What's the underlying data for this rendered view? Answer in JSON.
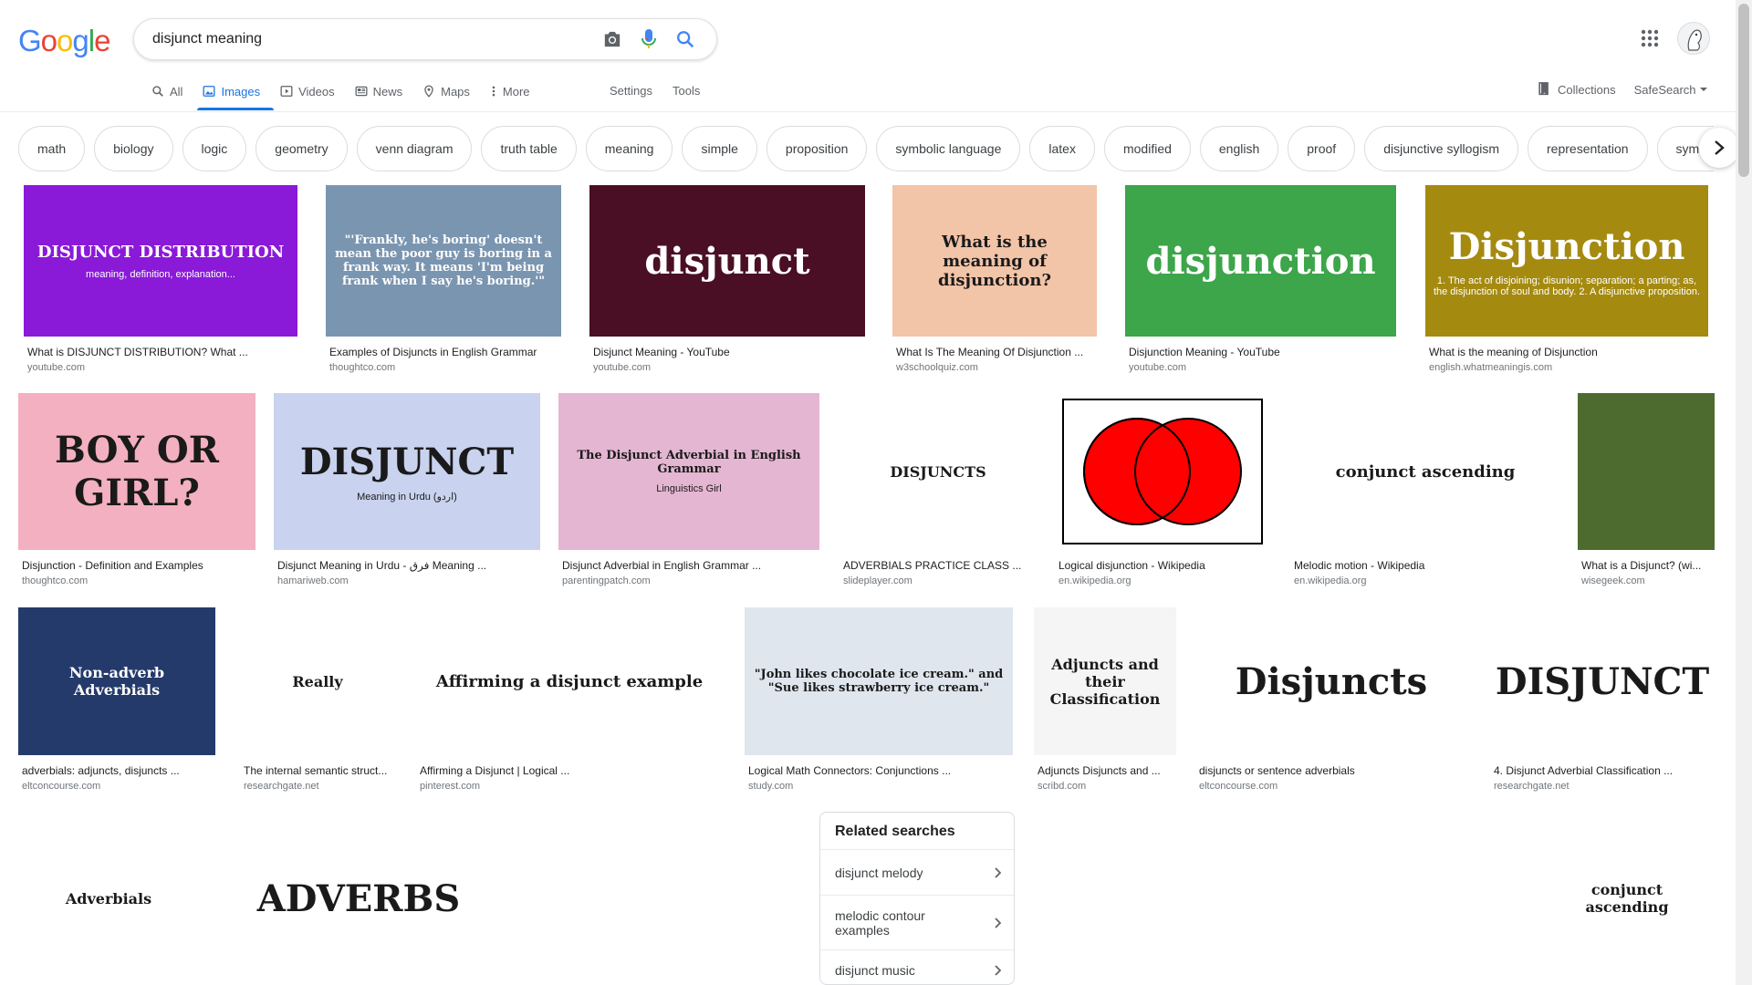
{
  "logo": {
    "letters": [
      "G",
      "o",
      "o",
      "g",
      "l",
      "e"
    ],
    "colors": [
      "#4285f4",
      "#ea4335",
      "#fbbc05",
      "#4285f4",
      "#34a853",
      "#ea4335"
    ]
  },
  "search": {
    "value": "disjunct meaning"
  },
  "tabs": [
    {
      "label": "All",
      "icon": "search-icon"
    },
    {
      "label": "Images",
      "icon": "image-icon",
      "active": true
    },
    {
      "label": "Videos",
      "icon": "play-icon"
    },
    {
      "label": "News",
      "icon": "news-icon"
    },
    {
      "label": "Maps",
      "icon": "map-pin-icon"
    },
    {
      "label": "More",
      "icon": "more-vert-icon"
    }
  ],
  "tools": {
    "settings": "Settings",
    "tools": "Tools"
  },
  "right_tools": {
    "collections": "Collections",
    "safesearch": "SafeSearch"
  },
  "chips": [
    "math",
    "biology",
    "logic",
    "geometry",
    "venn diagram",
    "truth table",
    "meaning",
    "simple",
    "proposition",
    "symbolic language",
    "latex",
    "modified",
    "english",
    "proof",
    "disjunctive syllogism",
    "representation",
    "symmetric"
  ],
  "results": [
    {
      "caption": "What is DISJUNCT DISTRIBUTION? What ...",
      "source": "youtube.com",
      "thumb_text": "DISJUNCT DISTRIBUTION",
      "thumb_sub": "meaning, definition, explanation...",
      "bg": "#8a19d8"
    },
    {
      "caption": "Examples of Disjuncts in English Grammar",
      "source": "thoughtco.com",
      "thumb_text": "\"'Frankly, he's boring' doesn't mean the poor guy is boring in a frank way. It means 'I'm being frank when I say he's boring.'\"",
      "bg": "#7a95b0"
    },
    {
      "caption": "Disjunct Meaning - YouTube",
      "source": "youtube.com",
      "thumb_text": "disjunct",
      "bg": "#4a0f24"
    },
    {
      "caption": "What Is The Meaning Of Disjunction ...",
      "source": "w3schoolquiz.com",
      "thumb_text": "What is the meaning of disjunction?",
      "bg": "#f2c4a8"
    },
    {
      "caption": "Disjunction Meaning - YouTube",
      "source": "youtube.com",
      "thumb_text": "disjunction",
      "bg": "#3da54a"
    },
    {
      "caption": "What is the meaning of Disjunction",
      "source": "english.whatmeaningis.com",
      "thumb_text": "Disjunction",
      "thumb_sub": "1. The act of disjoining; disunion; separation; a parting; as, the disjunction of soul and body. 2. A disjunctive proposition.",
      "bg": "#a58a10"
    },
    {
      "caption": "Disjunction - Definition and Examples",
      "source": "thoughtco.com",
      "thumb_text": "BOY OR GIRL?",
      "bg": "#f3b0c0"
    },
    {
      "caption": "Disjunct Meaning in Urdu - فرق Meaning ...",
      "source": "hamariweb.com",
      "thumb_text": "DISJUNCT",
      "thumb_sub": "Meaning in Urdu (اردو)",
      "bg": "#c9d3ef"
    },
    {
      "caption": "Disjunct Adverbial in English Grammar ...",
      "source": "parentingpatch.com",
      "thumb_text": "The Disjunct Adverbial in English Grammar",
      "thumb_sub": "Linguistics Girl",
      "bg": "#e4b6d2"
    },
    {
      "caption": "ADVERBIALS PRACTICE CLASS ...",
      "source": "slideplayer.com",
      "thumb_text": "DISJUNCTS",
      "bg": "#ffffff"
    },
    {
      "caption": "Logical disjunction - Wikipedia",
      "source": "en.wikipedia.org",
      "thumb_text": "",
      "bg": "#ffffff"
    },
    {
      "caption": "Melodic motion - Wikipedia",
      "source": "en.wikipedia.org",
      "thumb_text": "conjunct ascending",
      "bg": "#ffffff"
    },
    {
      "caption": "What is a Disjunct? (wi...",
      "source": "wisegeek.com",
      "thumb_text": "",
      "bg": "#4d6b2e"
    },
    {
      "caption": "adverbials: adjuncts, disjuncts ...",
      "source": "eltconcourse.com",
      "thumb_text": "Non-adverb Adverbials",
      "bg": "#243a6b"
    },
    {
      "caption": "The internal semantic struct...",
      "source": "researchgate.net",
      "thumb_text": "Really",
      "bg": "#ffffff"
    },
    {
      "caption": "Affirming a Disjunct | Logical ...",
      "source": "pinterest.com",
      "thumb_text": "Affirming a disjunct example",
      "bg": "#ffffff"
    },
    {
      "caption": "Logical Math Connectors: Conjunctions ...",
      "source": "study.com",
      "thumb_text": "\"John likes chocolate ice cream.\" and \"Sue likes strawberry ice cream.\"",
      "bg": "#dfe6ee"
    },
    {
      "caption": "Adjuncts Disjuncts and ...",
      "source": "scribd.com",
      "thumb_text": "Adjuncts and their Classification",
      "bg": "#f5f5f5"
    },
    {
      "caption": "disjuncts or sentence adverbials",
      "source": "eltconcourse.com",
      "thumb_text": "Disjuncts",
      "bg": "#ffffff"
    },
    {
      "caption": "4. Disjunct Adverbial Classification ...",
      "source": "researchgate.net",
      "thumb_text": "DISJUNCT",
      "bg": "#ffffff"
    },
    {
      "caption": "",
      "source": "",
      "thumb_text": "Adverbials",
      "bg": "#ffffff"
    },
    {
      "caption": "",
      "source": "",
      "thumb_text": "ADVERBS",
      "bg": "#ffffff"
    },
    {
      "caption": "",
      "source": "",
      "thumb_text": "",
      "bg": "#ffffff"
    },
    {
      "caption": "",
      "source": "",
      "thumb_text": "",
      "bg": "#ffffff"
    },
    {
      "caption": "",
      "source": "",
      "thumb_text": "",
      "bg": "#ffffff"
    },
    {
      "caption": "",
      "source": "",
      "thumb_text": "",
      "bg": "#ffffff"
    },
    {
      "caption": "",
      "source": "",
      "thumb_text": "conjunct ascending",
      "bg": "#ffffff"
    }
  ],
  "related": {
    "title": "Related searches",
    "items": [
      "disjunct melody",
      "melodic contour examples",
      "disjunct music"
    ]
  }
}
